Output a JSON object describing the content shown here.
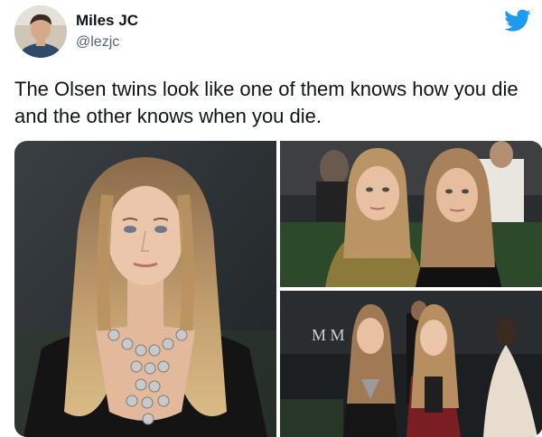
{
  "tweet": {
    "author_name": "Miles JC",
    "author_handle": "@lezjc",
    "text": "The Olsen twins look like one of them knows how you die and the other knows when you die."
  },
  "icons": {
    "platform": "twitter-bird-icon"
  },
  "colors": {
    "brand_blue": "#1d9bf0",
    "text_primary": "#0f1419",
    "text_secondary": "#536471"
  },
  "media": {
    "photos": [
      {
        "name": "photo-left",
        "subject": "portrait"
      },
      {
        "name": "photo-top-right",
        "subject": "two-women"
      },
      {
        "name": "photo-bottom-right",
        "subject": "two-women-full"
      }
    ]
  }
}
